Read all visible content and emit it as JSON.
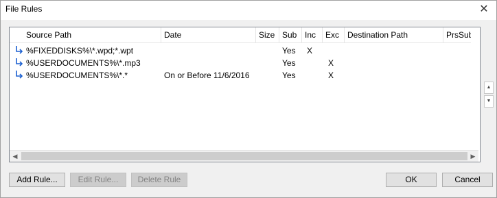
{
  "window": {
    "title": "File Rules",
    "close_glyph": "✕"
  },
  "grid": {
    "columns": [
      "Source Path",
      "Date",
      "Size",
      "Sub",
      "Inc",
      "Exc",
      "Destination Path",
      "PrsSub"
    ],
    "rows": [
      {
        "icon": "arrow-icon",
        "source_path": "%FIXEDDISKS%\\*.wpd;*.wpt",
        "date": "",
        "size": "",
        "sub": "Yes",
        "inc": "X",
        "exc": "",
        "destination_path": "",
        "prssub": ""
      },
      {
        "icon": "arrow-icon",
        "source_path": "%USERDOCUMENTS%\\*.mp3",
        "date": "",
        "size": "",
        "sub": "Yes",
        "inc": "",
        "exc": "X",
        "destination_path": "",
        "prssub": ""
      },
      {
        "icon": "arrow-icon",
        "source_path": "%USERDOCUMENTS%\\*.*",
        "date": "On or Before 11/6/2016",
        "size": "",
        "sub": "Yes",
        "inc": "",
        "exc": "X",
        "destination_path": "",
        "prssub": ""
      }
    ]
  },
  "buttons": {
    "add_rule": "Add Rule...",
    "edit_rule": "Edit Rule...",
    "delete_rule": "Delete Rule",
    "ok": "OK",
    "cancel": "Cancel"
  },
  "colors": {
    "arrow": "#1a5fd0",
    "border": "#828790"
  }
}
